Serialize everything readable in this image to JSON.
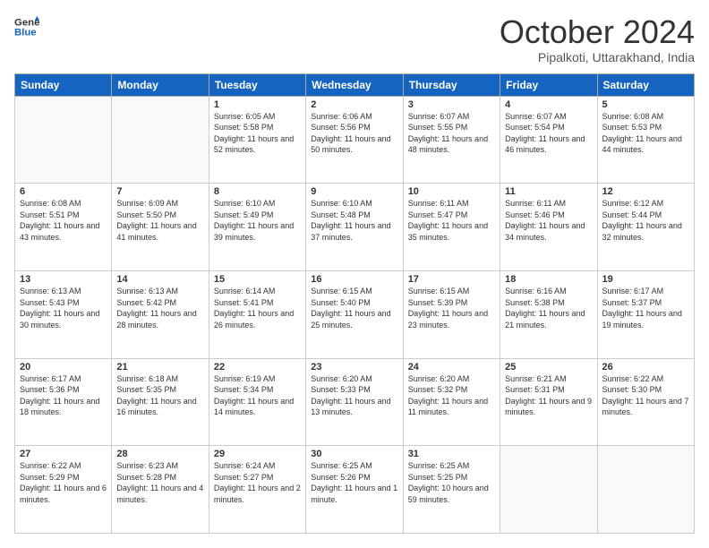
{
  "header": {
    "logo_line1": "General",
    "logo_line2": "Blue",
    "month": "October 2024",
    "location": "Pipalkoti, Uttarakhand, India"
  },
  "weekdays": [
    "Sunday",
    "Monday",
    "Tuesday",
    "Wednesday",
    "Thursday",
    "Friday",
    "Saturday"
  ],
  "weeks": [
    [
      {
        "day": "",
        "empty": true
      },
      {
        "day": "",
        "empty": true
      },
      {
        "day": "1",
        "sunrise": "6:05 AM",
        "sunset": "5:58 PM",
        "daylight": "11 hours and 52 minutes."
      },
      {
        "day": "2",
        "sunrise": "6:06 AM",
        "sunset": "5:56 PM",
        "daylight": "11 hours and 50 minutes."
      },
      {
        "day": "3",
        "sunrise": "6:07 AM",
        "sunset": "5:55 PM",
        "daylight": "11 hours and 48 minutes."
      },
      {
        "day": "4",
        "sunrise": "6:07 AM",
        "sunset": "5:54 PM",
        "daylight": "11 hours and 46 minutes."
      },
      {
        "day": "5",
        "sunrise": "6:08 AM",
        "sunset": "5:53 PM",
        "daylight": "11 hours and 44 minutes."
      }
    ],
    [
      {
        "day": "6",
        "sunrise": "6:08 AM",
        "sunset": "5:51 PM",
        "daylight": "11 hours and 43 minutes."
      },
      {
        "day": "7",
        "sunrise": "6:09 AM",
        "sunset": "5:50 PM",
        "daylight": "11 hours and 41 minutes."
      },
      {
        "day": "8",
        "sunrise": "6:10 AM",
        "sunset": "5:49 PM",
        "daylight": "11 hours and 39 minutes."
      },
      {
        "day": "9",
        "sunrise": "6:10 AM",
        "sunset": "5:48 PM",
        "daylight": "11 hours and 37 minutes."
      },
      {
        "day": "10",
        "sunrise": "6:11 AM",
        "sunset": "5:47 PM",
        "daylight": "11 hours and 35 minutes."
      },
      {
        "day": "11",
        "sunrise": "6:11 AM",
        "sunset": "5:46 PM",
        "daylight": "11 hours and 34 minutes."
      },
      {
        "day": "12",
        "sunrise": "6:12 AM",
        "sunset": "5:44 PM",
        "daylight": "11 hours and 32 minutes."
      }
    ],
    [
      {
        "day": "13",
        "sunrise": "6:13 AM",
        "sunset": "5:43 PM",
        "daylight": "11 hours and 30 minutes."
      },
      {
        "day": "14",
        "sunrise": "6:13 AM",
        "sunset": "5:42 PM",
        "daylight": "11 hours and 28 minutes."
      },
      {
        "day": "15",
        "sunrise": "6:14 AM",
        "sunset": "5:41 PM",
        "daylight": "11 hours and 26 minutes."
      },
      {
        "day": "16",
        "sunrise": "6:15 AM",
        "sunset": "5:40 PM",
        "daylight": "11 hours and 25 minutes."
      },
      {
        "day": "17",
        "sunrise": "6:15 AM",
        "sunset": "5:39 PM",
        "daylight": "11 hours and 23 minutes."
      },
      {
        "day": "18",
        "sunrise": "6:16 AM",
        "sunset": "5:38 PM",
        "daylight": "11 hours and 21 minutes."
      },
      {
        "day": "19",
        "sunrise": "6:17 AM",
        "sunset": "5:37 PM",
        "daylight": "11 hours and 19 minutes."
      }
    ],
    [
      {
        "day": "20",
        "sunrise": "6:17 AM",
        "sunset": "5:36 PM",
        "daylight": "11 hours and 18 minutes."
      },
      {
        "day": "21",
        "sunrise": "6:18 AM",
        "sunset": "5:35 PM",
        "daylight": "11 hours and 16 minutes."
      },
      {
        "day": "22",
        "sunrise": "6:19 AM",
        "sunset": "5:34 PM",
        "daylight": "11 hours and 14 minutes."
      },
      {
        "day": "23",
        "sunrise": "6:20 AM",
        "sunset": "5:33 PM",
        "daylight": "11 hours and 13 minutes."
      },
      {
        "day": "24",
        "sunrise": "6:20 AM",
        "sunset": "5:32 PM",
        "daylight": "11 hours and 11 minutes."
      },
      {
        "day": "25",
        "sunrise": "6:21 AM",
        "sunset": "5:31 PM",
        "daylight": "11 hours and 9 minutes."
      },
      {
        "day": "26",
        "sunrise": "6:22 AM",
        "sunset": "5:30 PM",
        "daylight": "11 hours and 7 minutes."
      }
    ],
    [
      {
        "day": "27",
        "sunrise": "6:22 AM",
        "sunset": "5:29 PM",
        "daylight": "11 hours and 6 minutes."
      },
      {
        "day": "28",
        "sunrise": "6:23 AM",
        "sunset": "5:28 PM",
        "daylight": "11 hours and 4 minutes."
      },
      {
        "day": "29",
        "sunrise": "6:24 AM",
        "sunset": "5:27 PM",
        "daylight": "11 hours and 2 minutes."
      },
      {
        "day": "30",
        "sunrise": "6:25 AM",
        "sunset": "5:26 PM",
        "daylight": "11 hours and 1 minute."
      },
      {
        "day": "31",
        "sunrise": "6:25 AM",
        "sunset": "5:25 PM",
        "daylight": "10 hours and 59 minutes."
      },
      {
        "day": "",
        "empty": true
      },
      {
        "day": "",
        "empty": true
      }
    ]
  ]
}
